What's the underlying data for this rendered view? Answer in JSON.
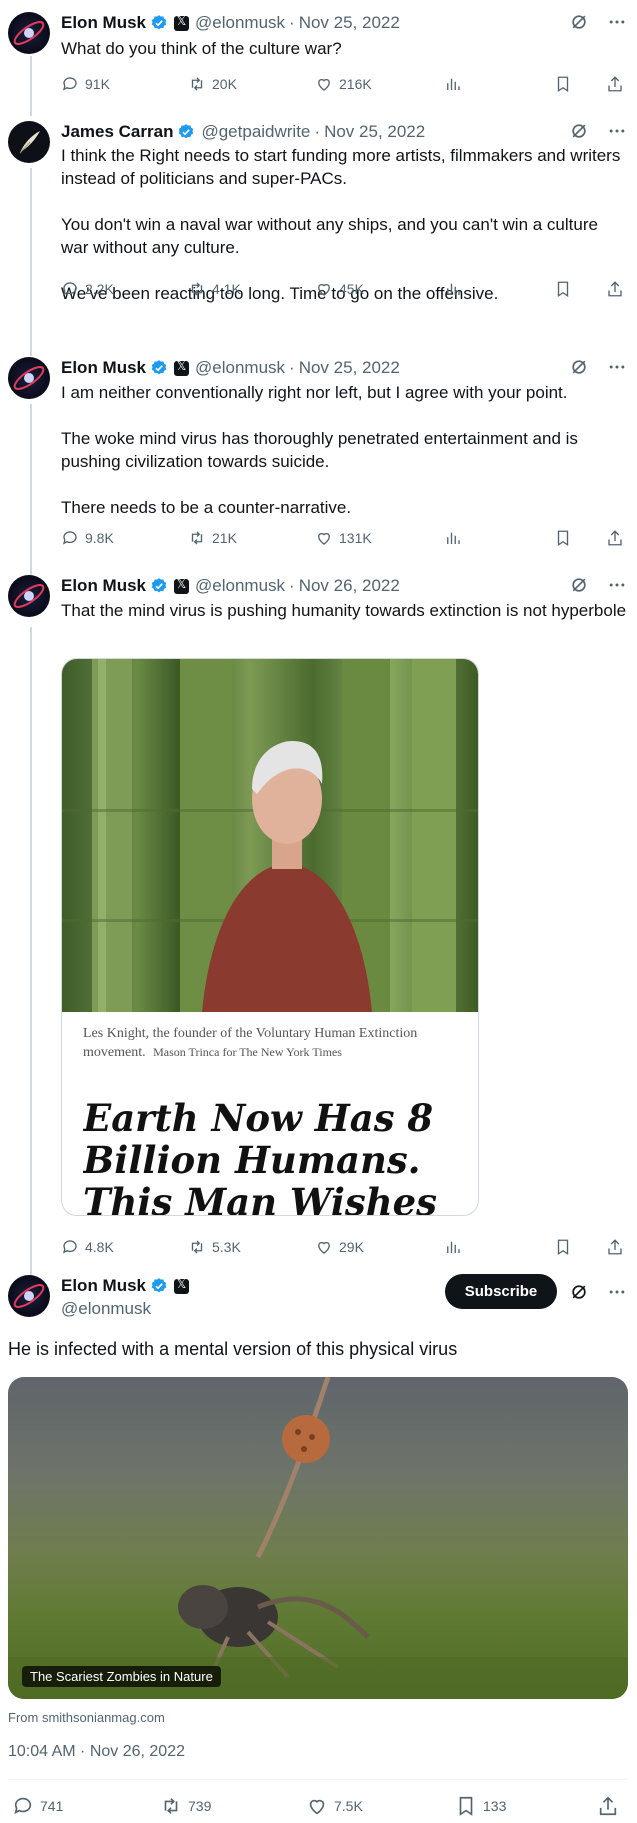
{
  "tweets": [
    {
      "name": "Elon Musk",
      "handle": "@elonmusk",
      "date": "Nov 25, 2022",
      "text": "What do you think of the culture war?",
      "replies": "91K",
      "retweets": "20K",
      "likes": "216K"
    },
    {
      "name": "James Carran",
      "handle": "@getpaidwrite",
      "date": "Nov 25, 2022",
      "text": "I think the Right needs to start funding more artists, filmmakers and writers instead of politicians and super-PACs.\n\nYou don't win a naval war without any ships, and you can't win a culture war without any culture.\n\nWe've been reacting too long. Time to go on the offensive.",
      "replies": "2.2K",
      "retweets": "4.1K",
      "likes": "45K"
    },
    {
      "name": "Elon Musk",
      "handle": "@elonmusk",
      "date": "Nov 25, 2022",
      "text": "I am neither conventionally right nor left, but I agree with your point.\n\nThe woke mind virus has thoroughly penetrated entertainment and is pushing civilization towards suicide.\n\nThere needs to be a counter-narrative.",
      "replies": "9.8K",
      "retweets": "21K",
      "likes": "131K"
    },
    {
      "name": "Elon Musk",
      "handle": "@elonmusk",
      "date": "Nov 26, 2022",
      "text": "That the mind virus is pushing humanity towards extinction is not hyperbole",
      "replies": "4.8K",
      "retweets": "5.3K",
      "likes": "29K",
      "card": {
        "caption_main": "Les Knight, the founder of the Voluntary Human Extinction movement.",
        "caption_credit": "Mason Trinca for The New York Times",
        "headline": "Earth Now Has 8 Billion Humans. This Man Wishes"
      }
    }
  ],
  "main": {
    "name": "Elon Musk",
    "handle": "@elonmusk",
    "subscribe_label": "Subscribe",
    "text": "He is infected with a mental version of this physical virus",
    "image_label": "The Scariest Zombies in Nature",
    "source": "From smithsonianmag.com",
    "timestamp": "10:04 AM · Nov 26, 2022",
    "replies": "741",
    "retweets": "739",
    "likes": "7.5K",
    "bookmarks": "133"
  },
  "colors": {
    "verified": "#1d9bf0",
    "secondary_text": "#536471",
    "thread_line": "#cfd9de"
  },
  "icons": [
    "reply-icon",
    "retweet-icon",
    "like-icon",
    "views-icon",
    "bookmark-icon",
    "share-icon",
    "grok-icon",
    "more-icon",
    "verified-icon",
    "x-badge-icon"
  ]
}
